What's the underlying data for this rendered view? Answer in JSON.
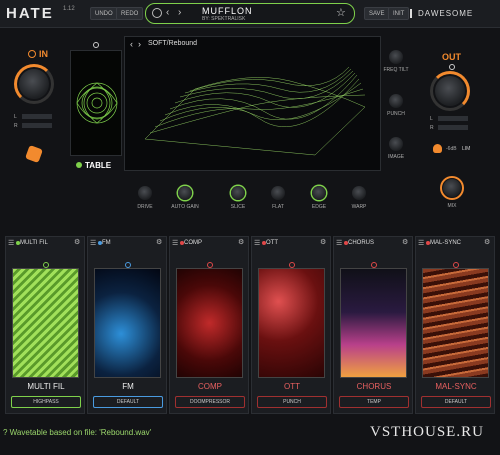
{
  "app": {
    "name": "HATE",
    "version": "1.12",
    "brand": "DAWESOME"
  },
  "toolbar": {
    "undo_label": "UNDO",
    "redo_label": "REDO",
    "save_label": "SAVE",
    "init_label": "INIT"
  },
  "preset": {
    "name": "MUFFLON",
    "author": "BY: SPEKTRALISK"
  },
  "input": {
    "label": "IN",
    "meter_l": "L",
    "meter_r": "R"
  },
  "output": {
    "label": "OUT",
    "meter_l": "L",
    "meter_r": "R",
    "db_value": "-6dB",
    "lim_label": "LIM",
    "mix_label": "MIX"
  },
  "table": {
    "label": "TABLE"
  },
  "display": {
    "title": "SOFT/Rebound"
  },
  "right_controls": [
    "FREQ TILT",
    "PUNCH",
    "IMAGE"
  ],
  "bottom_knobs": [
    "DRIVE",
    "AUTO GAIN",
    "SLICE",
    "FLAT",
    "EDGE",
    "WARP"
  ],
  "fx": [
    {
      "title": "MULTI FIL",
      "name": "MULTI FIL",
      "mode": "HIGHPASS",
      "color": "#7fd14b"
    },
    {
      "title": "FM",
      "name": "FM",
      "mode": "DEFAULT",
      "color": "#4a9be0"
    },
    {
      "title": "COMP",
      "name": "COMP",
      "mode": "DOOMPRESSOR",
      "color": "#e04848"
    },
    {
      "title": "OTT",
      "name": "OTT",
      "mode": "PUNCH",
      "color": "#e04848"
    },
    {
      "title": "CHORUS",
      "name": "CHORUS",
      "mode": "TEMP",
      "color": "#e04848"
    },
    {
      "title": "MAL-SYNC",
      "name": "MAL-SYNC",
      "mode": "DEFAULT",
      "color": "#e04848"
    }
  ],
  "status": "? Wavetable based on file: 'Rebound.wav'",
  "watermark": "VSTHOUSE.RU",
  "colors": {
    "accent_green": "#7fd14b",
    "accent_orange": "#f28a2e",
    "accent_red": "#e04848",
    "accent_blue": "#4a9be0"
  }
}
